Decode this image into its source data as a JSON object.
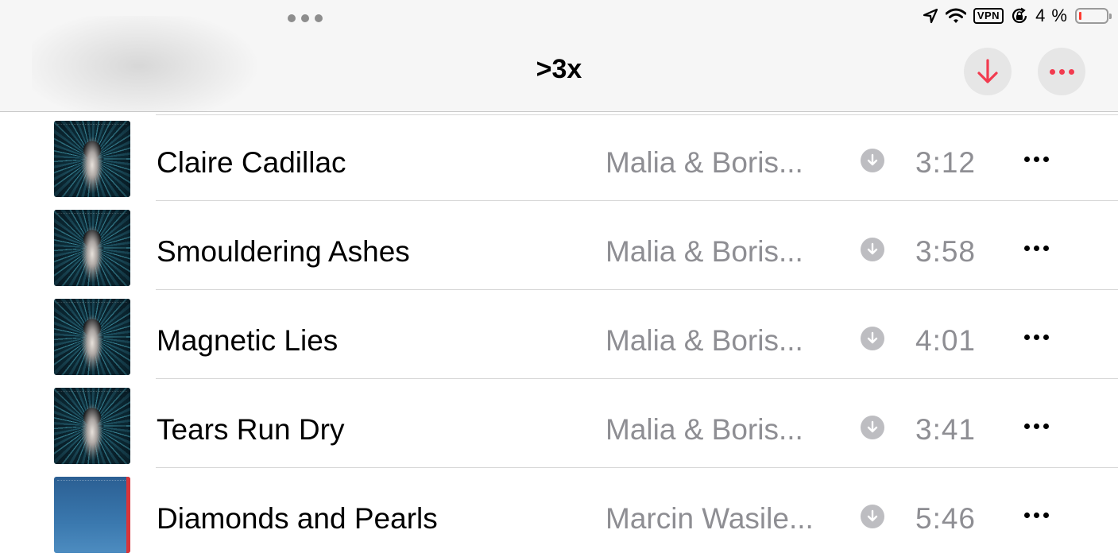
{
  "status_bar": {
    "icons": [
      "location-arrow-icon",
      "wifi-icon",
      "vpn-icon",
      "orientation-lock-icon",
      "battery-icon"
    ],
    "vpn_label": "VPN",
    "battery_percent": "4 %",
    "battery_level": 0.04
  },
  "header": {
    "title": ">3x",
    "download_icon": "arrow-down-icon",
    "more_icon": "ellipsis-icon",
    "accent_color": "#f23b4f"
  },
  "tracks": [
    {
      "title": "Claire Cadillac",
      "artist": "Malia & Boris...",
      "duration": "3:12",
      "downloaded": true
    },
    {
      "title": "Smouldering Ashes",
      "artist": "Malia & Boris...",
      "duration": "3:58",
      "downloaded": true
    },
    {
      "title": "Magnetic Lies",
      "artist": "Malia & Boris...",
      "duration": "4:01",
      "downloaded": true
    },
    {
      "title": "Tears Run Dry",
      "artist": "Malia & Boris...",
      "duration": "3:41",
      "downloaded": true
    },
    {
      "title": "Diamonds and Pearls",
      "artist": "Marcin Wasile...",
      "duration": "5:46",
      "downloaded": true
    }
  ]
}
